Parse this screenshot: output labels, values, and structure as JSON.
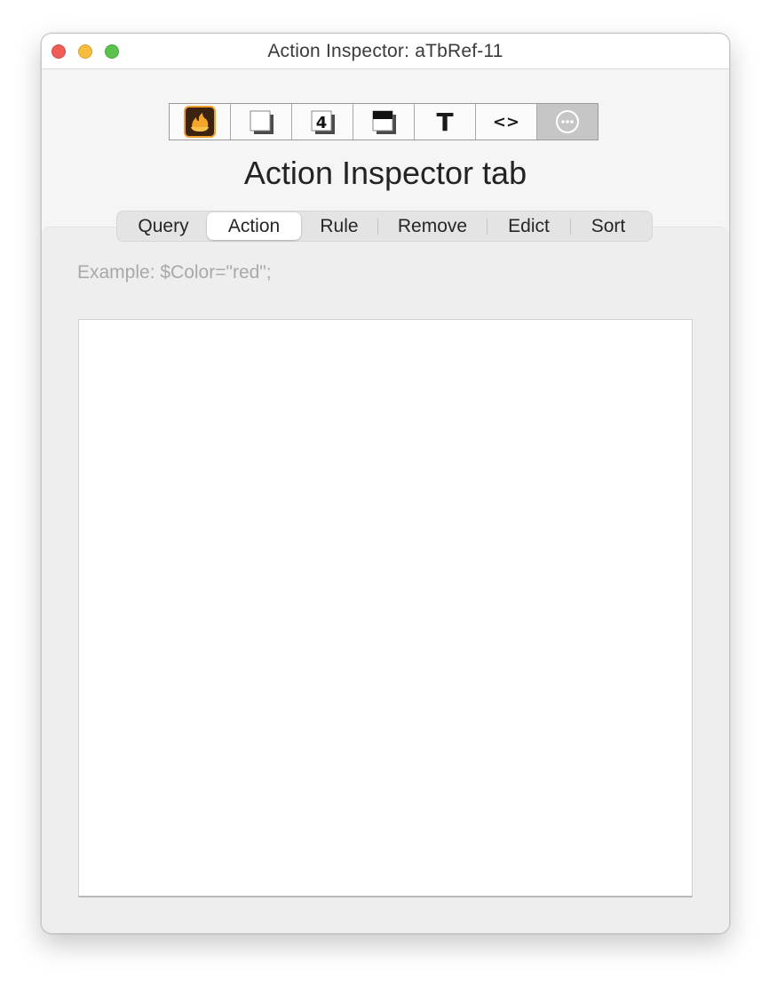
{
  "window": {
    "title": "Action Inspector: aTbRef-11",
    "controls": [
      "close",
      "minimize",
      "zoom"
    ]
  },
  "toolbar": {
    "buttons": [
      {
        "icon": "action-flame-icon",
        "selected": true
      },
      {
        "icon": "note-page-icon",
        "selected": false
      },
      {
        "icon": "number-4-icon",
        "selected": false
      },
      {
        "icon": "shadow-box-icon",
        "selected": false
      },
      {
        "icon": "text-T-icon",
        "selected": false
      },
      {
        "icon": "code-angle-brackets-icon",
        "selected": false
      },
      {
        "icon": "more-ellipsis-icon",
        "selected": false
      }
    ],
    "text_icon_label": "T",
    "code_icon_label": "<>",
    "number_icon_label": "4"
  },
  "heading": "Action Inspector tab",
  "tabs": {
    "items": [
      {
        "label": "Query",
        "active": false
      },
      {
        "label": "Action",
        "active": true
      },
      {
        "label": "Rule",
        "active": false
      },
      {
        "label": "Remove",
        "active": false
      },
      {
        "label": "Edict",
        "active": false
      },
      {
        "label": "Sort",
        "active": false
      }
    ]
  },
  "editor": {
    "placeholder": "Example: $Color=\"red\";",
    "value": ""
  },
  "colors": {
    "close": "#ee5e57",
    "minimize": "#f7bd3f",
    "zoom": "#5cc24e",
    "flame_icon_bg": "#4a2a10",
    "flame": "#f5a623"
  }
}
